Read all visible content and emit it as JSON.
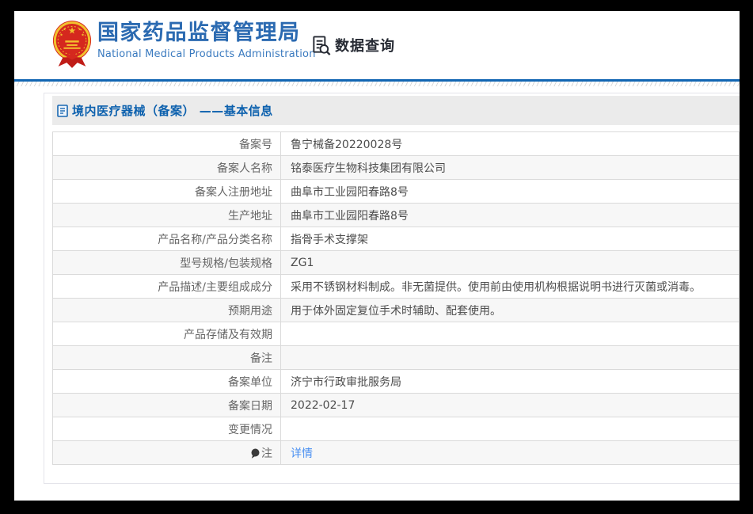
{
  "header": {
    "agency_cn": "国家药品监督管理局",
    "agency_en": "National Medical Products Administration",
    "nav_query_label": "数据查询"
  },
  "section": {
    "title": "境内医疗器械（备案） ——基本信息"
  },
  "record": {
    "rows": [
      {
        "label": "备案号",
        "value": "鲁宁械备20220028号"
      },
      {
        "label": "备案人名称",
        "value": "铭泰医疗生物科技集团有限公司"
      },
      {
        "label": "备案人注册地址",
        "value": "曲阜市工业园阳春路8号"
      },
      {
        "label": "生产地址",
        "value": "曲阜市工业园阳春路8号"
      },
      {
        "label": "产品名称/产品分类名称",
        "value": "指骨手术支撑架"
      },
      {
        "label": "型号规格/包装规格",
        "value": "ZG1"
      },
      {
        "label": "产品描述/主要组成成分",
        "value": "采用不锈钢材料制成。非无菌提供。使用前由使用机构根据说明书进行灭菌或消毒。"
      },
      {
        "label": "预期用途",
        "value": "用于体外固定复位手术时辅助、配套使用。"
      },
      {
        "label": "产品存储及有效期",
        "value": ""
      },
      {
        "label": "备注",
        "value": ""
      },
      {
        "label": "备案单位",
        "value": "济宁市行政审批服务局"
      },
      {
        "label": "备案日期",
        "value": "2022-02-17"
      },
      {
        "label": "变更情况",
        "value": ""
      },
      {
        "label": "注",
        "value": "详情",
        "icon": "note-bubble-icon",
        "link": true
      }
    ]
  },
  "icons": {
    "emblem": "china-national-emblem",
    "nav_query": "document-search-icon",
    "section": "document-icon",
    "note": "note-bubble-icon"
  },
  "colors": {
    "accent_blue": "#1266b3",
    "agency_blue": "#2b6ab1",
    "section_title_blue": "#0d61ae",
    "link_blue": "#4a90f2",
    "band_gray": "#ebebeb",
    "alt_row_gray": "#f7f7f7",
    "table_border": "#dadada"
  }
}
